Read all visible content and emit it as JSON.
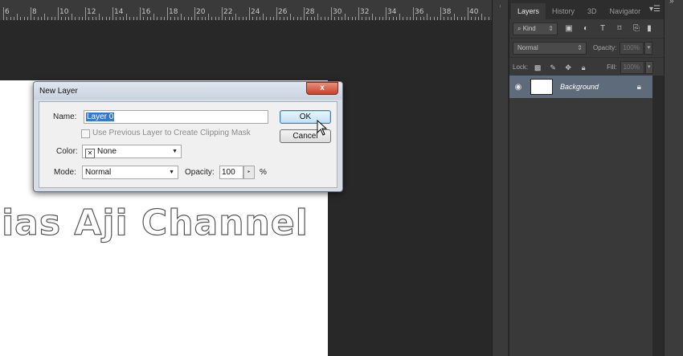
{
  "ruler": {
    "labels": [
      "6",
      "8",
      "10",
      "12",
      "14",
      "16",
      "18",
      "20",
      "22",
      "24",
      "26",
      "28",
      "30",
      "32",
      "34",
      "36",
      "38",
      "40"
    ]
  },
  "canvas": {
    "text": "lias Aji Channel"
  },
  "panel": {
    "tabs": [
      "Layers",
      "History",
      "3D",
      "Navigator"
    ],
    "active_tab": "Layers",
    "filter": {
      "label": "Kind",
      "icon": "search-icon"
    },
    "blend_mode": "Normal",
    "opacity_label": "Opacity:",
    "opacity_value": "100%",
    "lock_label": "Lock:",
    "fill_label": "Fill:",
    "fill_value": "100%",
    "layers": [
      {
        "name": "Background",
        "visible": true,
        "locked": true
      }
    ],
    "selection_color": "#5e6b7a"
  },
  "dialog": {
    "title": "New Layer",
    "close": "x",
    "name_label": "Name:",
    "name_value": "Layer 0",
    "clipping_label": "Use Previous Layer to Create Clipping Mask",
    "color_label": "Color:",
    "color_value": "None",
    "mode_label": "Mode:",
    "mode_value": "Normal",
    "opacity_label": "Opacity:",
    "opacity_value": "100",
    "opacity_unit": "%",
    "ok_label": "OK",
    "cancel_label": "Cancel"
  }
}
